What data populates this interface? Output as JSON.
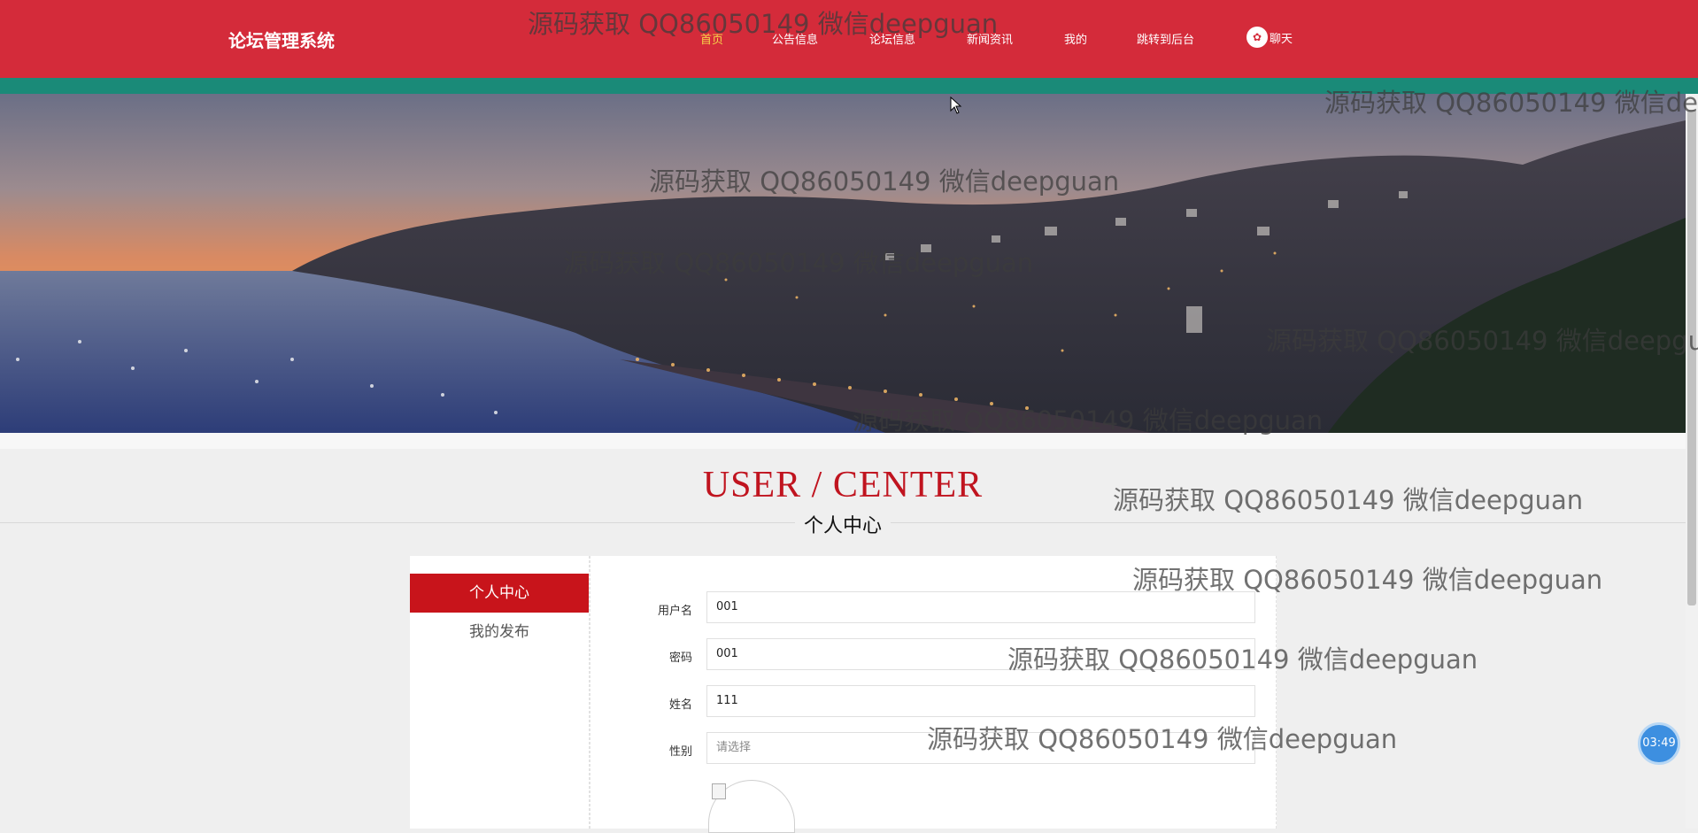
{
  "header": {
    "brand": "论坛管理系统",
    "nav": [
      {
        "label": "首页",
        "active": true
      },
      {
        "label": "公告信息",
        "active": false
      },
      {
        "label": "论坛信息",
        "active": false
      },
      {
        "label": "新闻资讯",
        "active": false
      },
      {
        "label": "我的",
        "active": false
      },
      {
        "label": "跳转到后台",
        "active": false
      }
    ],
    "chat_label": "聊天",
    "chat_icon": "wechat-chat-icon"
  },
  "section": {
    "title": "USER / CENTER",
    "subtitle": "个人中心"
  },
  "sidebar": {
    "items": [
      {
        "label": "个人中心",
        "active": true
      },
      {
        "label": "我的发布",
        "active": false
      }
    ]
  },
  "form": {
    "username": {
      "label": "用户名",
      "value": "001"
    },
    "password": {
      "label": "密码",
      "value": "001"
    },
    "name": {
      "label": "姓名",
      "value": "111"
    },
    "gender": {
      "label": "性别",
      "placeholder": "请选择"
    }
  },
  "timer": "03:49",
  "watermark_text": "源码获取 QQ86050149 微信deepguan",
  "colors": {
    "header": "#d42b3a",
    "stripe": "#1a8a78",
    "accent_red": "#c8141b",
    "active_nav": "#f7d54a"
  }
}
